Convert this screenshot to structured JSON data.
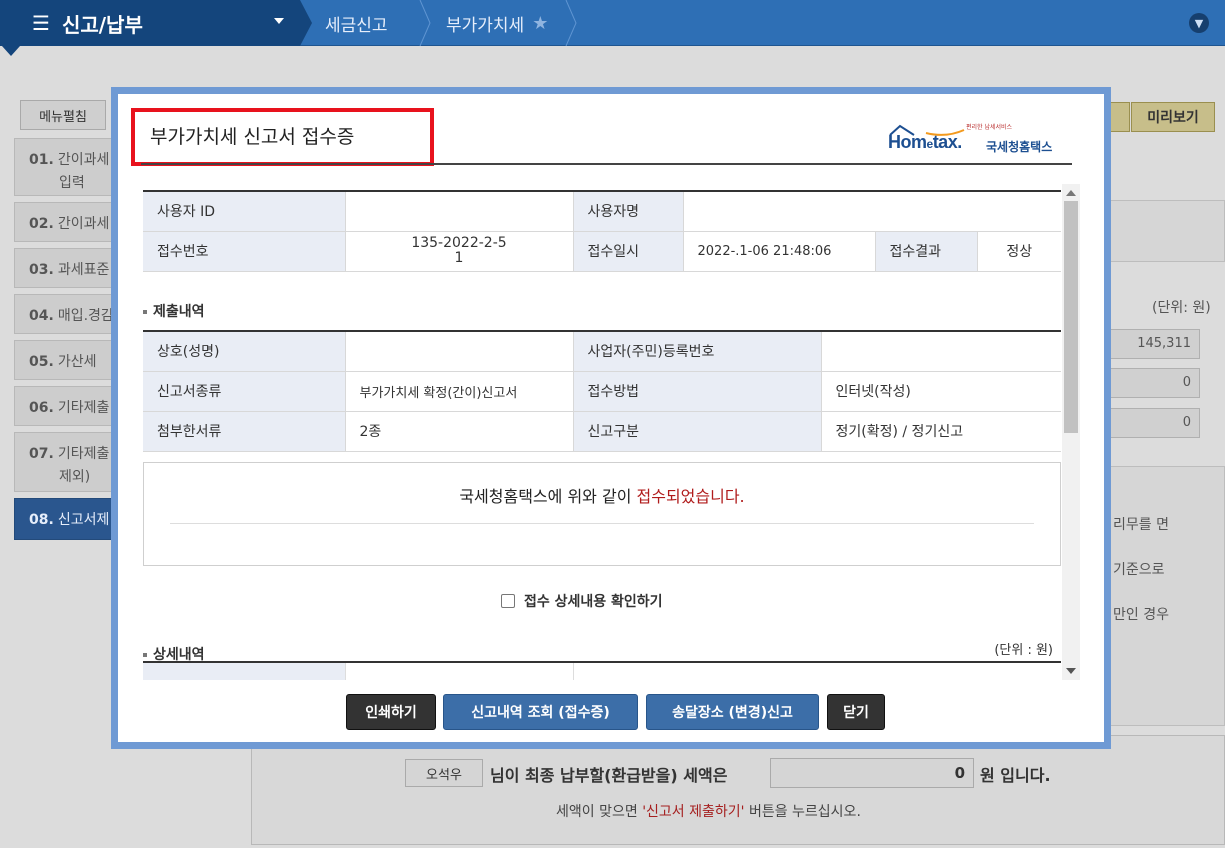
{
  "nav": {
    "menu_title": "신고/납부",
    "breadcrumbs": [
      "세금신고",
      "부가가치세"
    ]
  },
  "sidebar": {
    "edit_label": "메뉴펼침",
    "items": [
      {
        "no": "01.",
        "label": "간이과세",
        "label2": "입력"
      },
      {
        "no": "02.",
        "label": "간이과세"
      },
      {
        "no": "03.",
        "label": "과세표준"
      },
      {
        "no": "04.",
        "label": "매입.경감"
      },
      {
        "no": "05.",
        "label": "가산세"
      },
      {
        "no": "06.",
        "label": "기타제출"
      },
      {
        "no": "07.",
        "label": "기타제출",
        "label2": "제외)"
      },
      {
        "no": "08.",
        "label": "신고서제"
      }
    ]
  },
  "background": {
    "preview_label": "미리보기",
    "unit_label": "(단위: 원)",
    "field_values": [
      "145,311",
      "0",
      "0"
    ],
    "texts": [
      "리무를 면",
      "기준으로",
      "만인 경우"
    ]
  },
  "summary": {
    "name": "오석우",
    "sentence": "님이 최종 납부할(환급받을) 세액은",
    "amount": "0",
    "won": "원 입니다.",
    "note_prefix": "세액이 맞으면 ",
    "note_highlight": "'신고서 제출하기'",
    "note_suffix": " 버튼을 누르십시오."
  },
  "modal": {
    "title": "부가가치세 신고서 접수증",
    "logo": {
      "tiny": "편리한 납세서비스",
      "brand_a": "Hom",
      "brand_e": "e",
      "brand_b": "tax.",
      "org": "국세청홈택스"
    },
    "info": {
      "user_id_label": "사용자 ID",
      "user_id_value": "",
      "user_name_label": "사용자명",
      "user_name_value": "",
      "receipt_no_label": "접수번호",
      "receipt_no_value": "135-2022-2-5",
      "receipt_no_value2": "1",
      "receipt_time_label": "접수일시",
      "receipt_time_value": "2022-.1-06 21:48:06",
      "result_label": "접수결과",
      "result_value": "정상"
    },
    "submission": {
      "section_title": "제출내역",
      "company_label": "상호(성명)",
      "company_value": "",
      "reg_no_label": "사업자(주민)등록번호",
      "reg_no_value": "",
      "type_label": "신고서종류",
      "type_value": "부가가치세 확정(간이)신고서",
      "method_label": "접수방법",
      "method_value": "인터넷(작성)",
      "attach_label": "첨부한서류",
      "attach_value": "2종",
      "category_label": "신고구분",
      "category_value": "정기(확정) / 정기신고"
    },
    "notice": {
      "prefix": "국세청홈택스에 위와 같이 ",
      "highlight": "접수되었습니다."
    },
    "confirm_label": "접수 상세내용 확인하기",
    "detail_title": "상세내역",
    "detail_unit": "(단위 : 원)",
    "buttons": {
      "print": "인쇄하기",
      "history": "신고내역 조회 (접수증)",
      "address": "송달장소 (변경)신고",
      "close": "닫기"
    }
  },
  "colors": {
    "nav_blue": "#2e6fb5",
    "nav_dark": "#14457c",
    "highlight_red": "#e8121d",
    "modal_border": "#6f9ad4",
    "header_cell": "#e9edf5",
    "accent_red_text": "#b01b1b"
  }
}
